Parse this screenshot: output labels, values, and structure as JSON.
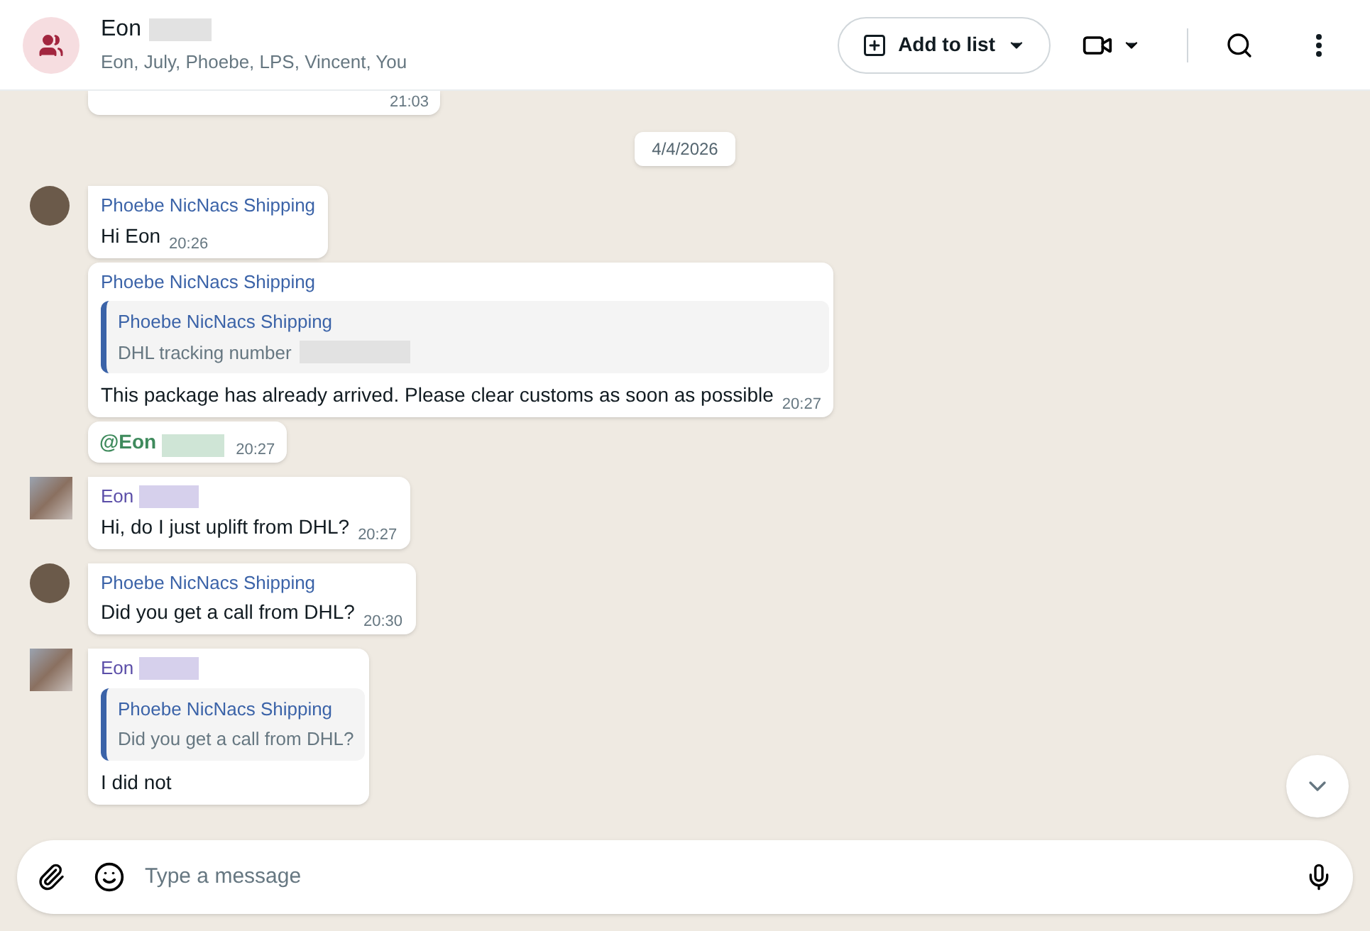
{
  "header": {
    "title": "Eon",
    "title_redacted": true,
    "members": "Eon, July, Phoebe, LPS, Vincent, You",
    "add_to_list": "Add to list"
  },
  "messages": [
    {
      "kind": "partial",
      "time": "21:03"
    },
    {
      "kind": "date",
      "text": "4/4/2026"
    },
    {
      "kind": "message",
      "avatar": {
        "kind": "photo"
      },
      "first": true,
      "sender": "Phoebe NicNacs Shipping",
      "color": "#3b63a8",
      "text": "Hi Eon",
      "time": "20:26"
    },
    {
      "kind": "message",
      "first": false,
      "sender": "Phoebe NicNacs Shipping",
      "color": "#3b63a8",
      "quote": {
        "sender": "Phoebe NicNacs Shipping",
        "text": "DHL tracking number",
        "redacted": true
      },
      "text": "This package has already arrived. Please clear customs as soon as possible",
      "time": "20:27"
    },
    {
      "kind": "mention",
      "text": "@Eon",
      "redacted": true,
      "time": "20:27"
    },
    {
      "kind": "message",
      "avatar": {
        "kind": "pixelated"
      },
      "first": true,
      "sender": "Eon",
      "color": "#5b4ea8",
      "sender_redacted": true,
      "text": "Hi, do I just uplift from DHL?",
      "time": "20:27"
    },
    {
      "kind": "message",
      "avatar": {
        "kind": "photo"
      },
      "first": true,
      "sender": "Phoebe NicNacs Shipping",
      "color": "#3b63a8",
      "text": "Did you get a call from DHL?",
      "time": "20:30"
    },
    {
      "kind": "message",
      "avatar": {
        "kind": "pixelated"
      },
      "first": true,
      "sender": "Eon",
      "color": "#5b4ea8",
      "sender_redacted": true,
      "quote": {
        "sender": "Phoebe NicNacs Shipping",
        "text": "Did you get a call from DHL?"
      },
      "text": "I did not"
    }
  ],
  "composer": {
    "placeholder": "Type a message"
  }
}
